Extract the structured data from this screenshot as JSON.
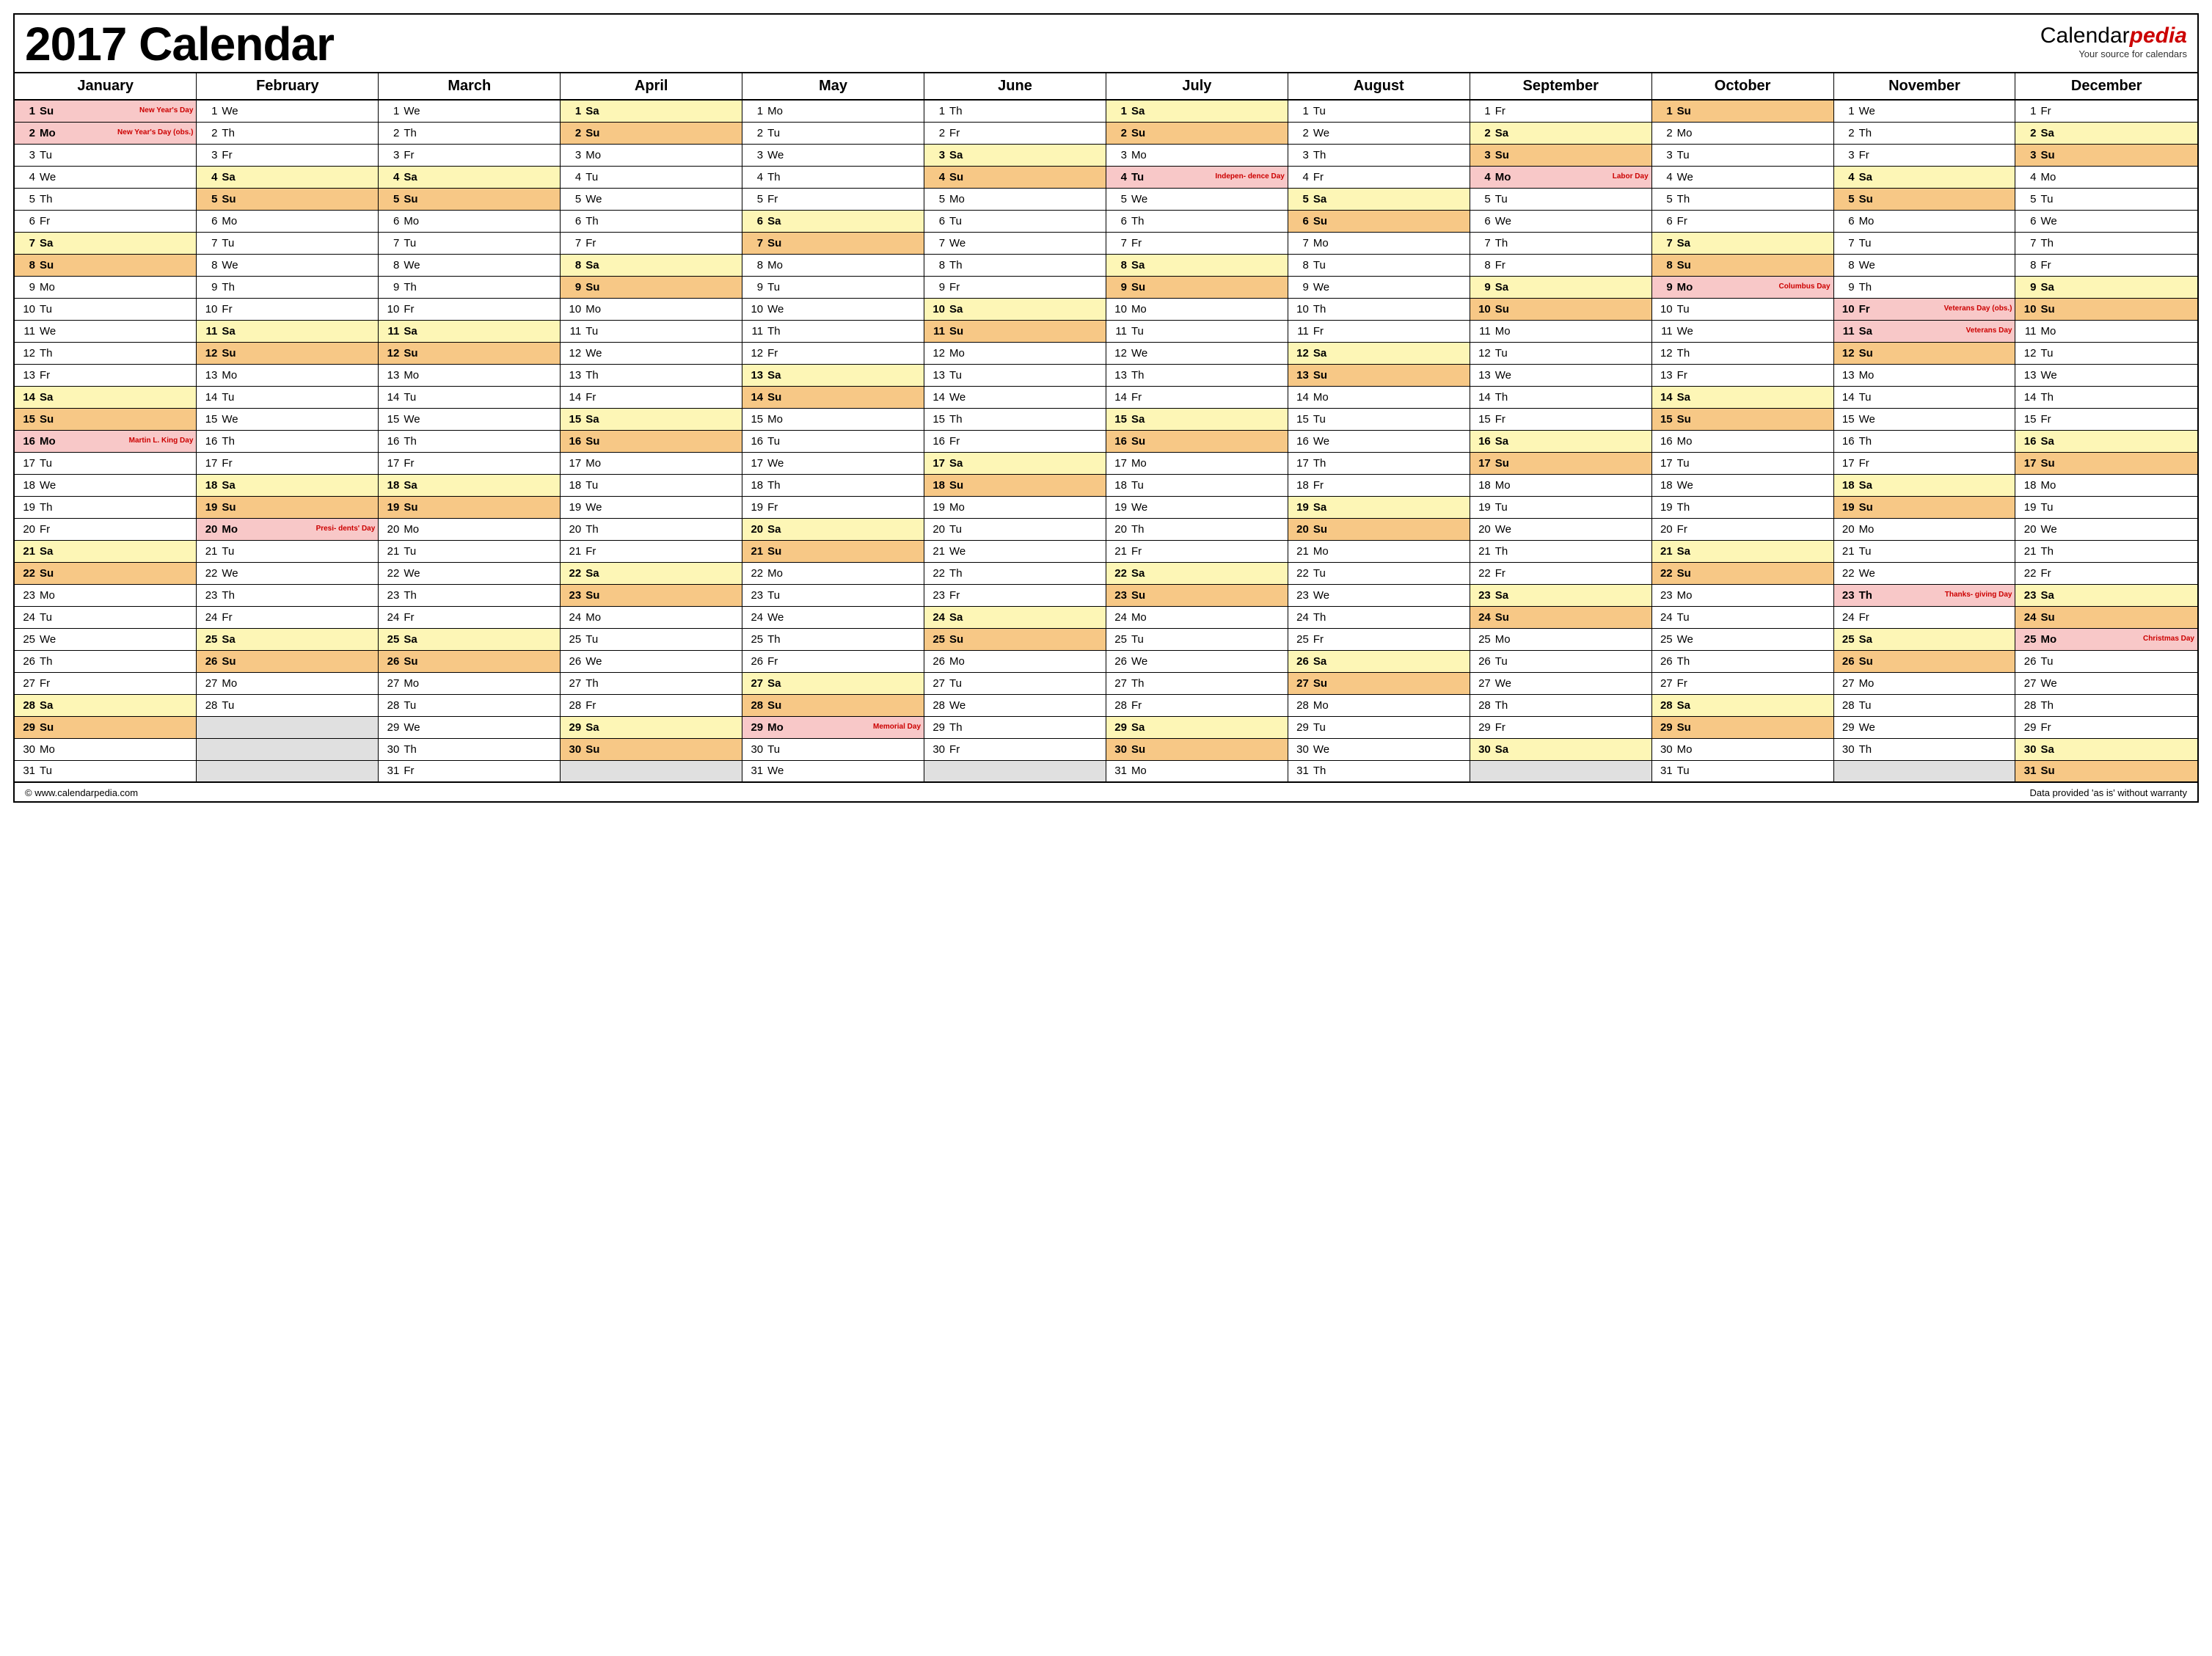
{
  "title": "2017 Calendar",
  "brand": {
    "part1": "Calendar",
    "part2": "pedia",
    "tagline": "Your source for calendars"
  },
  "footer": {
    "left": "© www.calendarpedia.com",
    "right": "Data provided 'as is' without warranty"
  },
  "months": [
    "January",
    "February",
    "March",
    "April",
    "May",
    "June",
    "July",
    "August",
    "September",
    "October",
    "November",
    "December"
  ],
  "weekday_abbr": [
    "Su",
    "Mo",
    "Tu",
    "We",
    "Th",
    "Fr",
    "Sa"
  ],
  "month_lengths": [
    31,
    28,
    31,
    30,
    31,
    30,
    31,
    31,
    30,
    31,
    30,
    31
  ],
  "first_weekday": [
    0,
    3,
    3,
    6,
    1,
    4,
    6,
    2,
    5,
    0,
    3,
    5
  ],
  "holidays": {
    "0": {
      "1": "New Year's Day",
      "2": "New Year's Day (obs.)",
      "16": "Martin L. King Day"
    },
    "1": {
      "20": "Presi- dents' Day"
    },
    "4": {
      "29": "Memorial Day"
    },
    "6": {
      "4": "Indepen- dence Day"
    },
    "8": {
      "4": "Labor Day"
    },
    "9": {
      "9": "Columbus Day"
    },
    "10": {
      "10": "Veterans Day (obs.)",
      "11": "Veterans Day",
      "23": "Thanks- giving Day"
    },
    "11": {
      "25": "Christmas Day"
    }
  }
}
